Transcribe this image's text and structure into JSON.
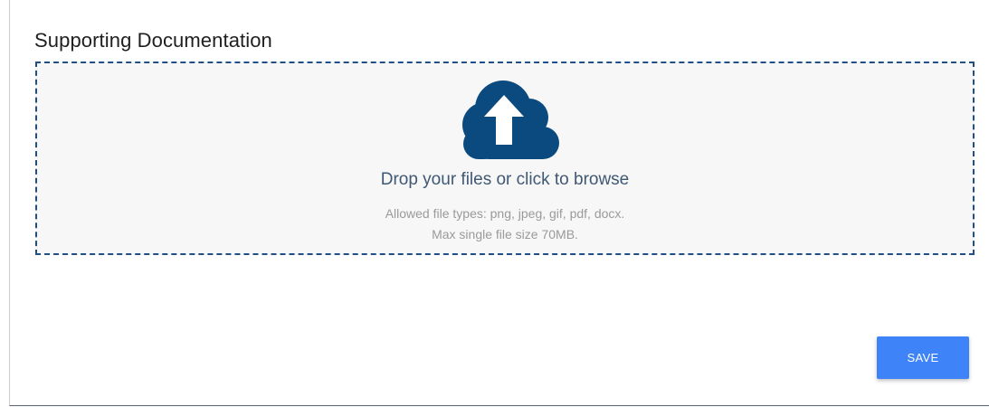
{
  "section": {
    "title": "Supporting Documentation"
  },
  "dropzone": {
    "icon": "cloud-upload-icon",
    "prompt": "Drop your files or click to browse",
    "allowed_types": "Allowed file types: png, jpeg, gif, pdf, docx.",
    "max_size": "Max single file size 70MB."
  },
  "actions": {
    "save_label": "SAVE"
  },
  "colors": {
    "accent": "#3f83f8",
    "dropzone_border": "#1f4f86",
    "icon": "#0b4a7f"
  }
}
